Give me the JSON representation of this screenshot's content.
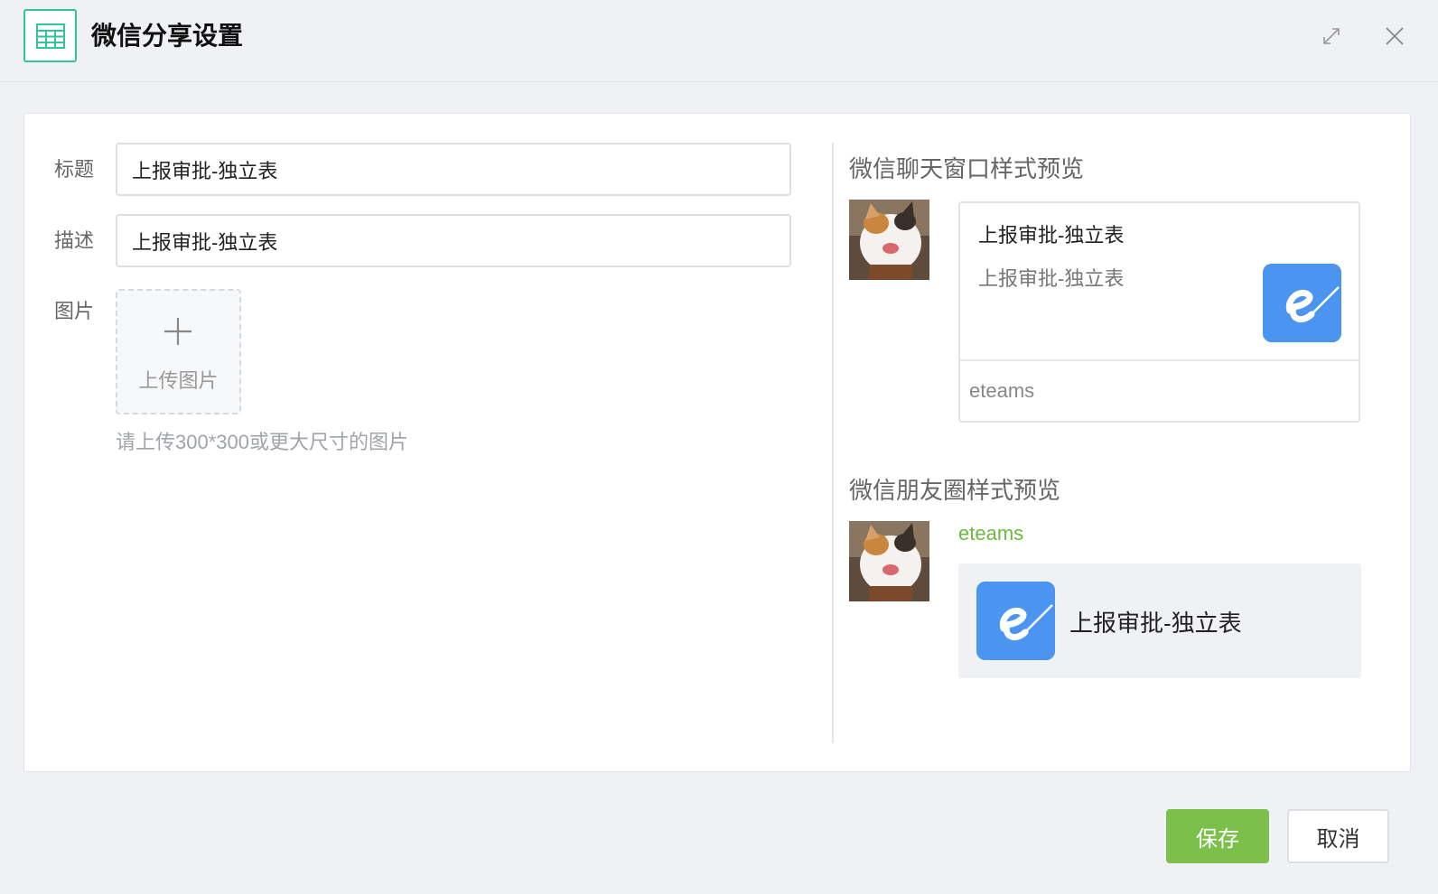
{
  "dialog": {
    "title": "微信分享设置",
    "icon": "table-icon",
    "accent_color": "#33c29a"
  },
  "form": {
    "title_label": "标题",
    "title_value": "上报审批-独立表",
    "desc_label": "描述",
    "desc_value": "上报审批-独立表",
    "image_label": "图片",
    "upload_label": "上传图片",
    "upload_hint": "请上传300*300或更大尺寸的图片"
  },
  "preview": {
    "chat_section_title": "微信聊天窗口样式预览",
    "chat_title": "上报审批-独立表",
    "chat_desc": "上报审批-独立表",
    "chat_source": "eteams",
    "moments_section_title": "微信朋友圈样式预览",
    "moments_user": "eteams",
    "moments_title": "上报审批-独立表",
    "logo_color": "#4b95f0",
    "user_color": "#6cba3e"
  },
  "actions": {
    "save_label": "保存",
    "cancel_label": "取消",
    "save_color": "#7cbf4a"
  }
}
